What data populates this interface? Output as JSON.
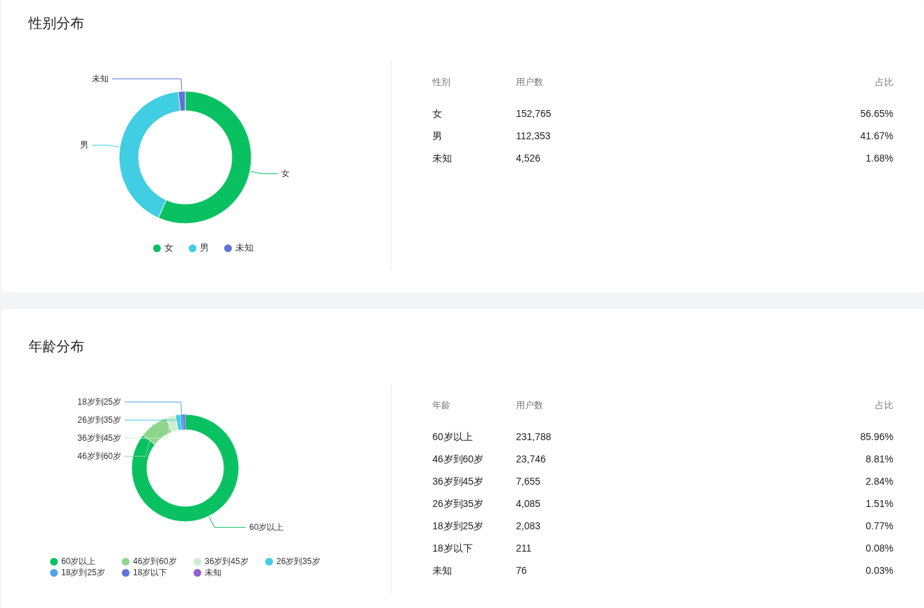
{
  "sections": [
    {
      "title": "性别分布",
      "chart_data": {
        "type": "donut",
        "categories": [
          "女",
          "男",
          "未知"
        ],
        "colors": [
          "#0ac161",
          "#41cde2",
          "#5f74d6"
        ],
        "legend": "bottom",
        "series": [
          {
            "values": [
              56.65,
              41.67,
              1.68
            ]
          }
        ],
        "annotations": [
          {
            "text": "未知",
            "x": "未知"
          },
          {
            "text": "男",
            "x": "男"
          },
          {
            "text": "女",
            "x": "女"
          }
        ]
      },
      "table": {
        "columns": [
          "性别",
          "用户数",
          "占比"
        ],
        "rows": [
          [
            "女",
            "152,765",
            "56.65%"
          ],
          [
            "男",
            "112,353",
            "41.67%"
          ],
          [
            "未知",
            "4,526",
            "1.68%"
          ]
        ]
      }
    },
    {
      "title": "年龄分布",
      "chart_data": {
        "type": "donut",
        "categories": [
          "60岁以上",
          "46岁到60岁",
          "36岁到45岁",
          "26岁到35岁",
          "18岁到25岁",
          "18岁以下",
          "未知"
        ],
        "colors": [
          "#0ac161",
          "#8fd58c",
          "#cdeecf",
          "#41cde2",
          "#4fa3ee",
          "#5f74d6",
          "#8e60d0"
        ],
        "legend": "bottom",
        "series": [
          {
            "values": [
              85.96,
              8.81,
              2.84,
              1.51,
              0.77,
              0.08,
              0.03
            ]
          }
        ],
        "annotations": [
          {
            "text": "18岁到25岁",
            "x": "18岁到25岁"
          },
          {
            "text": "26岁到35岁",
            "x": "26岁到35岁"
          },
          {
            "text": "36岁到45岁",
            "x": "36岁到45岁"
          },
          {
            "text": "46岁到60岁",
            "x": "46岁到60岁"
          },
          {
            "text": "60岁以上",
            "x": "60岁以上"
          }
        ]
      },
      "table": {
        "columns": [
          "年龄",
          "用户数",
          "占比"
        ],
        "rows": [
          [
            "60岁以上",
            "231,788",
            "85.96%"
          ],
          [
            "46岁到60岁",
            "23,746",
            "8.81%"
          ],
          [
            "36岁到45岁",
            "7,655",
            "2.84%"
          ],
          [
            "26岁到35岁",
            "4,085",
            "1.51%"
          ],
          [
            "18岁到25岁",
            "2,083",
            "0.77%"
          ],
          [
            "18岁以下",
            "211",
            "0.08%"
          ],
          [
            "未知",
            "76",
            "0.03%"
          ]
        ]
      }
    }
  ]
}
